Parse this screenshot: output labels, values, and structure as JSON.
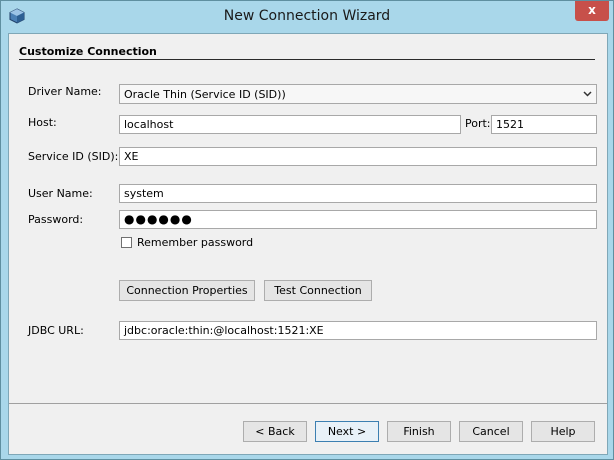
{
  "window": {
    "title": "New Connection Wizard",
    "close_glyph": "x"
  },
  "section": {
    "title": "Customize Connection"
  },
  "form": {
    "driver_label": "Driver Name:",
    "driver_value": "Oracle Thin (Service ID (SID))",
    "host_label": "Host:",
    "host_value": "localhost",
    "port_label": "Port:",
    "port_value": "1521",
    "sid_label": "Service ID (SID):",
    "sid_value": "XE",
    "user_label": "User Name:",
    "user_value": "system",
    "password_label": "Password:",
    "password_masked": "●●●●●●",
    "remember_label": "Remember password",
    "remember_checked": false,
    "jdbc_label": "JDBC URL:",
    "jdbc_value": "jdbc:oracle:thin:@localhost:1521:XE"
  },
  "actions": {
    "connection_properties": "Connection Properties",
    "test_connection": "Test Connection"
  },
  "footer": {
    "back": "< Back",
    "next": "Next >",
    "finish": "Finish",
    "cancel": "Cancel",
    "help": "Help"
  },
  "icons": {
    "app": "netbeans-cube-icon",
    "close": "close-icon",
    "dropdown": "chevron-down-icon"
  },
  "colors": {
    "titlebar": "#a9d7ea",
    "close_button": "#c7504a",
    "dialog_background": "#f0f0f0",
    "default_button_border": "#3c7fb1"
  }
}
